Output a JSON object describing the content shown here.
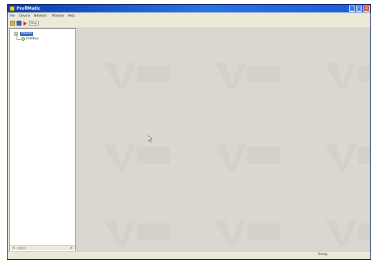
{
  "window": {
    "title": "ProfiMatic",
    "buttons": {
      "minimize": "_",
      "maximize": "□",
      "close": "×"
    }
  },
  "menu": {
    "items": [
      "File",
      "Device",
      "Network",
      "Window",
      "Help"
    ]
  },
  "toolbar": {
    "open_icon": "folder-open-icon",
    "save_icon": "save-disk-icon",
    "run_icon": "play-icon",
    "stop_label": "Stop"
  },
  "tree": {
    "root_label": "Master",
    "child_label": "Profibus"
  },
  "scrollbar": {
    "left_arrow": "◂",
    "right_arrow": "▸"
  },
  "workspace": {
    "background_color": "#d9d7d0",
    "watermark_icon": "vendor-logo-watermark"
  },
  "status": {
    "text": "Ready"
  },
  "colors": {
    "titlebar": "#2a74e4",
    "selection": "#316ac5",
    "close_button": "#d8552e"
  }
}
